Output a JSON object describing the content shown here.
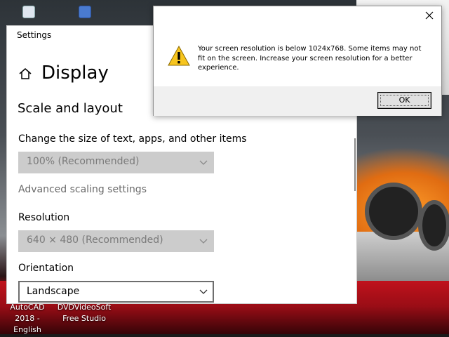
{
  "desktop": {
    "icons": [
      {
        "name": "AutoCAD",
        "label_line1": "AutoCAD",
        "label_line2": "2018 - English"
      },
      {
        "name": "DVDVideoSoft",
        "label_line1": "DVDVideoSoft",
        "label_line2": "Free Studio"
      }
    ]
  },
  "settings": {
    "window_title": "Settings",
    "page_title": "Display",
    "section_title": "Scale and layout",
    "scale_label": "Change the size of text, apps, and other items",
    "scale_value": "100% (Recommended)",
    "advanced_link": "Advanced scaling settings",
    "resolution_label": "Resolution",
    "resolution_value": "640 × 480 (Recommended)",
    "orientation_label": "Orientation",
    "orientation_value": "Landscape"
  },
  "dialog": {
    "message": "Your screen resolution is below 1024x768. Some items may not fit on the screen. Increase your screen resolution for a better experience.",
    "ok_label": "OK"
  },
  "colors": {
    "accent_red": "#c0121c",
    "disabled_dropdown": "#cccccc",
    "dialog_footer": "#f0f0f0"
  }
}
